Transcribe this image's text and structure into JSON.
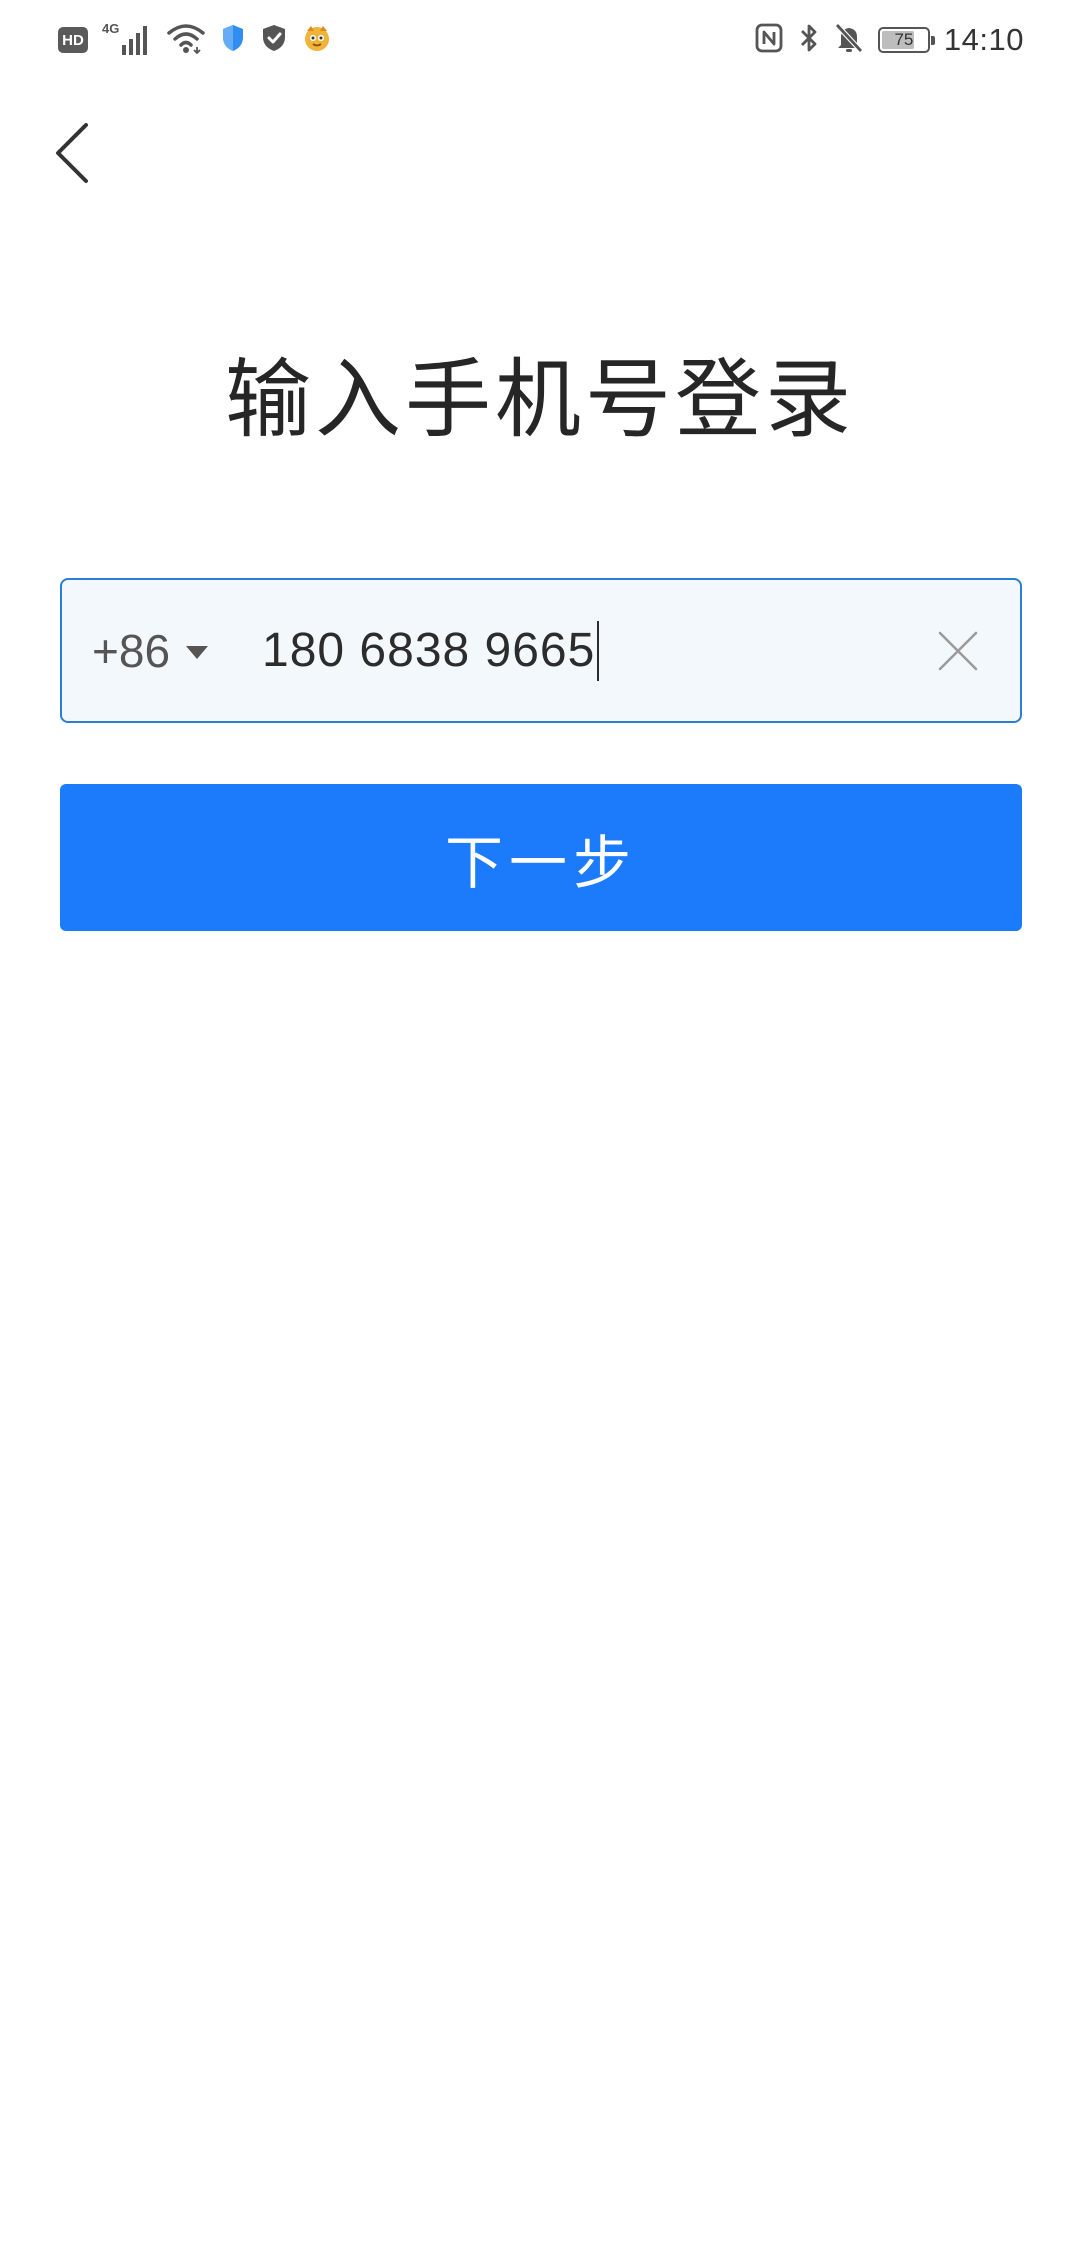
{
  "status_bar": {
    "hd_label": "HD",
    "network_label": "4G",
    "time": "14:10",
    "battery_level": "75",
    "battery_fraction": 0.75,
    "left_icons": [
      "hd-icon",
      "signal-icon",
      "wifi-icon",
      "shield-blue-icon",
      "shield-check-icon",
      "app-mascot-icon"
    ],
    "right_icons": [
      "nfc-icon",
      "bluetooth-icon",
      "bell-off-icon",
      "battery-icon"
    ]
  },
  "header": {
    "back_icon": "chevron-left-icon"
  },
  "main": {
    "title": "输入手机号登录",
    "phone": {
      "country_code": "+86",
      "value": "180 6838 9665",
      "clear_icon": "close-icon"
    },
    "next_button_label": "下一步"
  },
  "colors": {
    "primary": "#1b7bfa",
    "input_border": "#2a7fd4",
    "input_bg": "#f3f8fd",
    "title_text": "#262626"
  }
}
